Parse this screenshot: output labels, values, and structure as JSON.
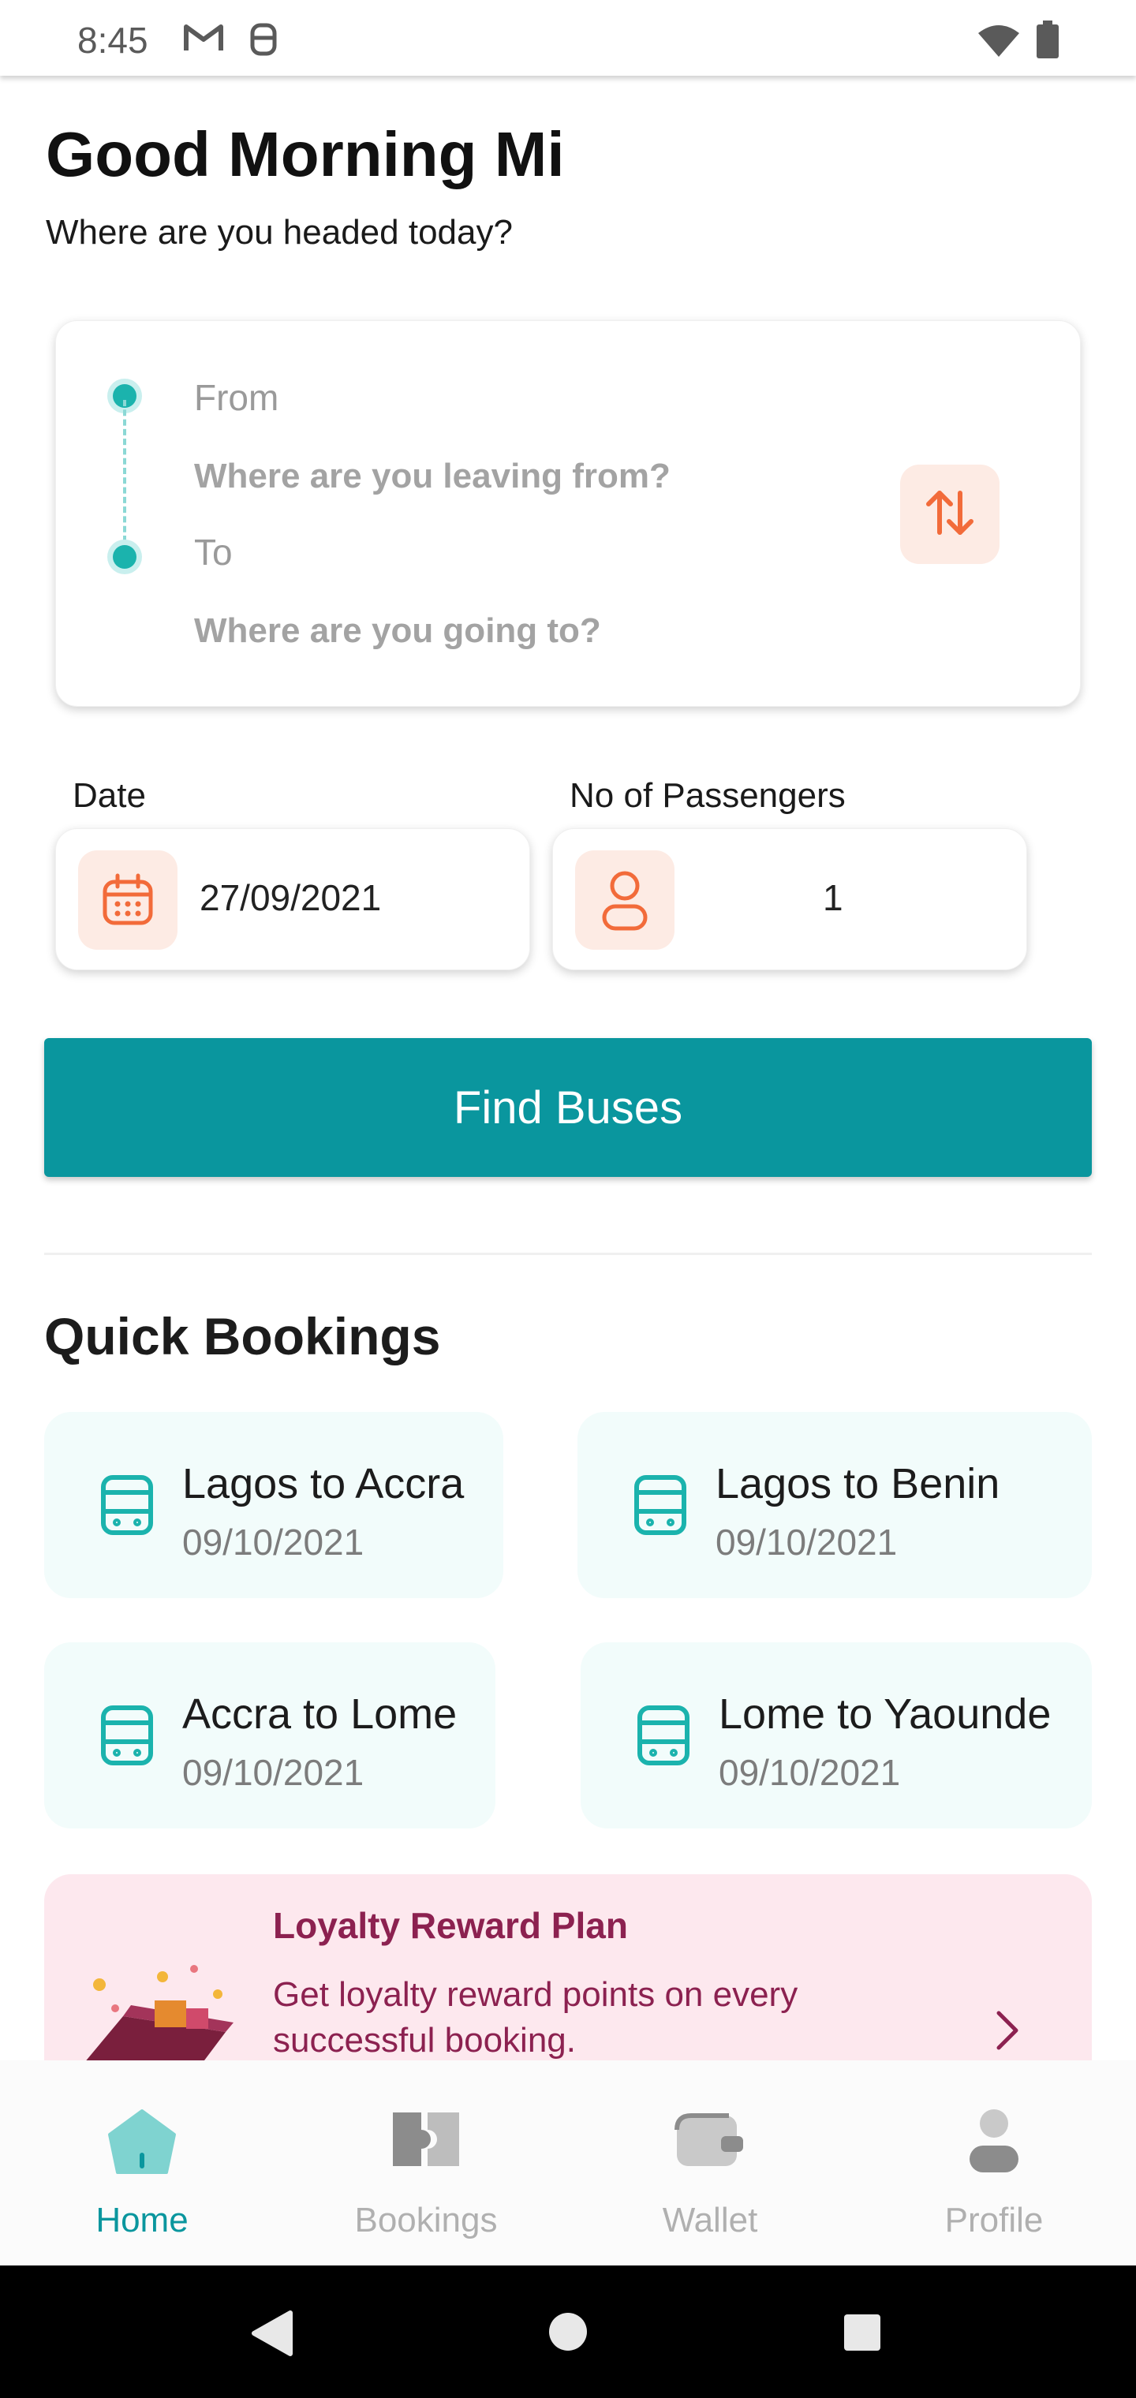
{
  "status_bar": {
    "time": "8:45",
    "icons": [
      "gmail-icon",
      "notification-icon",
      "wifi-icon",
      "battery-icon"
    ]
  },
  "header": {
    "greeting": "Good Morning Mi",
    "subtitle": "Where are you headed today?"
  },
  "route": {
    "from_label": "From",
    "from_placeholder": "Where are you leaving from?",
    "to_label": "To",
    "to_placeholder": "Where are you going to?",
    "swap_icon": "swap-arrows-icon"
  },
  "date": {
    "label": "Date",
    "value": "27/09/2021",
    "icon": "calendar-icon"
  },
  "passengers": {
    "label": "No of Passengers",
    "value": "1",
    "icon": "person-icon"
  },
  "find_button": "Find Buses",
  "quick_bookings": {
    "title": "Quick Bookings",
    "items": [
      {
        "route": "Lagos to Accra",
        "date": "09/10/2021"
      },
      {
        "route": "Lagos to Benin",
        "date": "09/10/2021"
      },
      {
        "route": "Accra to Lome",
        "date": "09/10/2021"
      },
      {
        "route": "Lome to Yaounde",
        "date": "09/10/2021"
      }
    ]
  },
  "loyalty": {
    "title": "Loyalty Reward Plan",
    "description": "Get loyalty reward points on every successful booking."
  },
  "bottom_nav": {
    "active": "Home",
    "items": [
      {
        "label": "Home",
        "icon": "home-icon"
      },
      {
        "label": "Bookings",
        "icon": "ticket-icon"
      },
      {
        "label": "Wallet",
        "icon": "wallet-icon"
      },
      {
        "label": "Profile",
        "icon": "profile-icon"
      }
    ]
  },
  "colors": {
    "primary": "#0a969e",
    "accent": "#f26b3a",
    "accent_bg": "#fdebe4",
    "route_dot": "#1bb3ad",
    "card_bg": "#f2fcfb",
    "loyalty_bg": "#fde8ee",
    "loyalty_text": "#8c2150",
    "nav_inactive": "#b0b0b0"
  }
}
